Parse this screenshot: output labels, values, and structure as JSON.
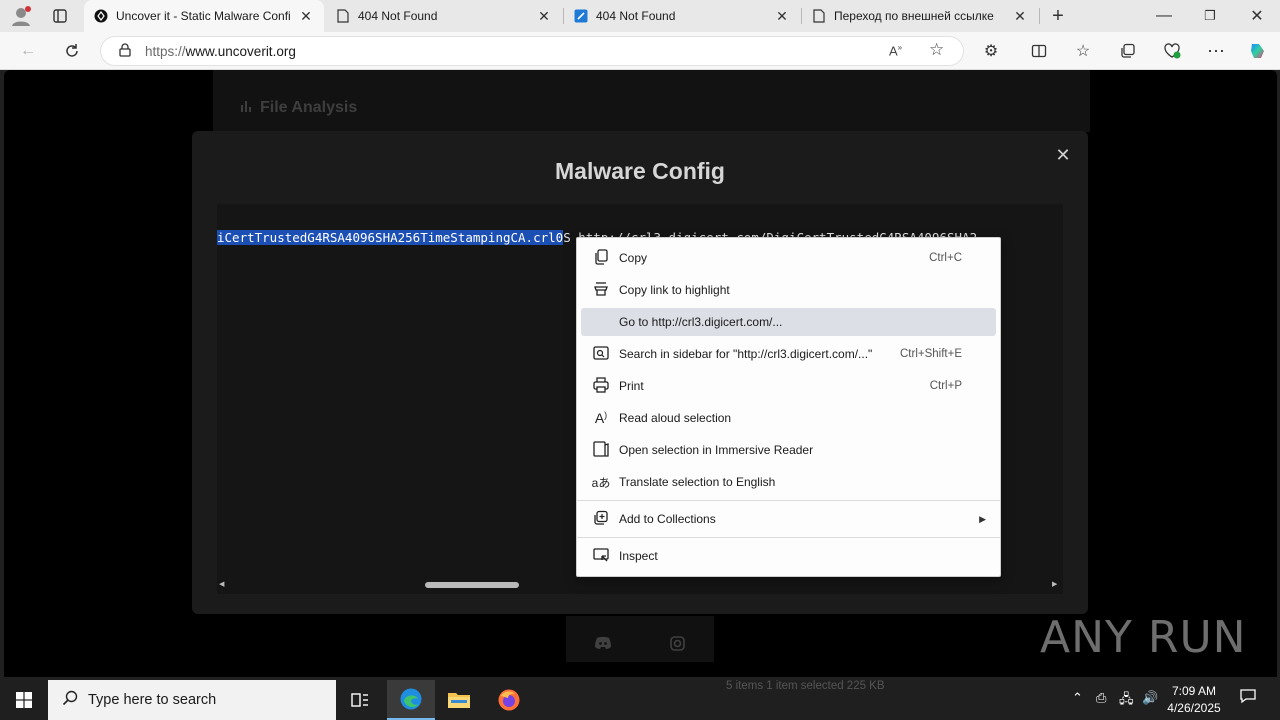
{
  "browser": {
    "tabs": [
      {
        "title": "Uncover it - Static Malware Confi",
        "active": true
      },
      {
        "title": "404 Not Found",
        "active": false
      },
      {
        "title": "404 Not Found",
        "active": false
      },
      {
        "title": "Переход по внешней ссылке",
        "active": false
      }
    ],
    "address": {
      "protocol": "https://",
      "host": "www.uncoverit.org"
    }
  },
  "page": {
    "section_title": "File Analysis",
    "modal": {
      "title": "Malware Config",
      "code_selected": "iCertTrustedG4RSA4096SHA256TimeStampingCA.crl0",
      "code_rest": "S  http://crl3.digicert.com/DigiCertTrustedG4RSA4096SHA2"
    }
  },
  "context_menu": {
    "items": [
      {
        "label": "Copy",
        "shortcut": "Ctrl+C",
        "icon": "copy-icon"
      },
      {
        "label": "Copy link to highlight",
        "shortcut": "",
        "icon": "highlight-link-icon"
      },
      {
        "label": "Go to http://crl3.digicert.com/...",
        "shortcut": "",
        "icon": ""
      },
      {
        "label": "Search in sidebar for \"http://crl3.digicert.com/...\"",
        "shortcut": "Ctrl+Shift+E",
        "icon": "sidebar-search-icon"
      },
      {
        "label": "Print",
        "shortcut": "Ctrl+P",
        "icon": "print-icon"
      },
      {
        "label": "Read aloud selection",
        "shortcut": "",
        "icon": "read-aloud-icon"
      },
      {
        "label": "Open selection in Immersive Reader",
        "shortcut": "",
        "icon": "immersive-reader-icon"
      },
      {
        "label": "Translate selection to English",
        "shortcut": "",
        "icon": "translate-icon"
      },
      {
        "label": "Add to Collections",
        "shortcut": "",
        "icon": "collections-icon"
      },
      {
        "label": "Inspect",
        "shortcut": "",
        "icon": "inspect-icon"
      }
    ]
  },
  "watermark": "ANY RUN",
  "taskbar": {
    "search_placeholder": "Type here to search",
    "time": "7:09 AM",
    "date": "4/26/2025",
    "background_status": "5 items     1 item selected  225 KB"
  }
}
